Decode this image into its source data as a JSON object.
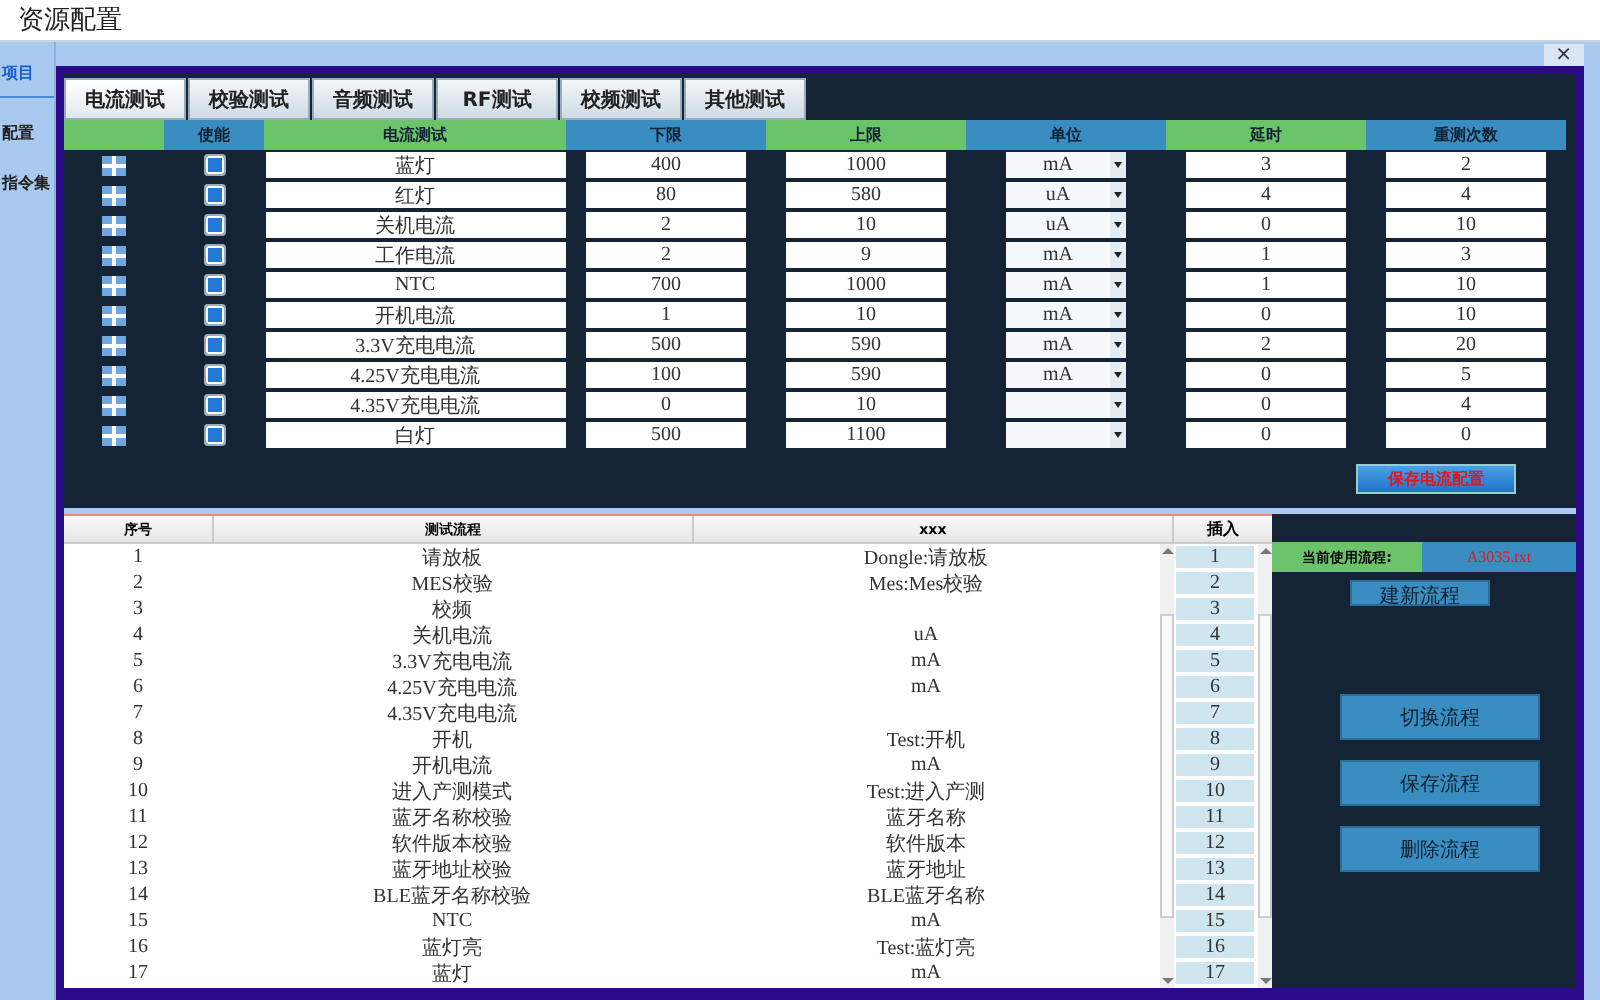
{
  "window": {
    "title": "资源配置",
    "close": "×"
  },
  "sidebar": {
    "items": [
      {
        "label": "项目",
        "selected": true
      },
      {
        "label": "配置",
        "selected": false
      },
      {
        "label": "指令集",
        "selected": false
      }
    ]
  },
  "tabs": [
    {
      "label": "电流测试",
      "selected": true
    },
    {
      "label": "校验测试",
      "selected": false
    },
    {
      "label": "音频测试",
      "selected": false
    },
    {
      "label": "RF测试",
      "selected": false
    },
    {
      "label": "校频测试",
      "selected": false
    },
    {
      "label": "其他测试",
      "selected": false
    }
  ],
  "current_table": {
    "columns": [
      "",
      "使能",
      "电流测试",
      "下限",
      "上限",
      "单位",
      "延时",
      "重测次数"
    ],
    "rows": [
      {
        "enabled": true,
        "name": "蓝灯",
        "low": "400",
        "high": "1000",
        "unit": "mA",
        "delay": "3",
        "retries": "2"
      },
      {
        "enabled": true,
        "name": "红灯",
        "low": "80",
        "high": "580",
        "unit": "uA",
        "delay": "4",
        "retries": "4"
      },
      {
        "enabled": true,
        "name": "关机电流",
        "low": "2",
        "high": "10",
        "unit": "uA",
        "delay": "0",
        "retries": "10"
      },
      {
        "enabled": true,
        "name": "工作电流",
        "low": "2",
        "high": "9",
        "unit": "mA",
        "delay": "1",
        "retries": "3"
      },
      {
        "enabled": true,
        "name": "NTC",
        "low": "700",
        "high": "1000",
        "unit": "mA",
        "delay": "1",
        "retries": "10"
      },
      {
        "enabled": true,
        "name": "开机电流",
        "low": "1",
        "high": "10",
        "unit": "mA",
        "delay": "0",
        "retries": "10"
      },
      {
        "enabled": true,
        "name": "3.3V充电电流",
        "low": "500",
        "high": "590",
        "unit": "mA",
        "delay": "2",
        "retries": "20"
      },
      {
        "enabled": true,
        "name": "4.25V充电电流",
        "low": "100",
        "high": "590",
        "unit": "mA",
        "delay": "0",
        "retries": "5"
      },
      {
        "enabled": true,
        "name": "4.35V充电电流",
        "low": "0",
        "high": "10",
        "delay": "0",
        "retries": "4"
      },
      {
        "enabled": true,
        "name": "白灯",
        "low": "500",
        "high": "1100",
        "delay": "0",
        "retries": "0"
      }
    ],
    "save_button": "保存电流配置"
  },
  "flow_table": {
    "columns": [
      "序号",
      "测试流程",
      "xxx"
    ],
    "insert_column": "插入",
    "rows": [
      {
        "index": "1",
        "step": "请放板",
        "value": "Dongle:请放板"
      },
      {
        "index": "2",
        "step": "MES校验",
        "value": "Mes:Mes校验"
      },
      {
        "index": "3",
        "step": "校频"
      },
      {
        "index": "4",
        "step": "关机电流",
        "value": "uA"
      },
      {
        "index": "5",
        "step": "3.3V充电电流",
        "value": "mA"
      },
      {
        "index": "6",
        "step": "4.25V充电电流",
        "value": "mA"
      },
      {
        "index": "7",
        "step": "4.35V充电电流"
      },
      {
        "index": "8",
        "step": "开机",
        "value": "Test:开机"
      },
      {
        "index": "9",
        "step": "开机电流",
        "value": "mA"
      },
      {
        "index": "10",
        "step": "进入产测模式",
        "value": "Test:进入产测"
      },
      {
        "index": "11",
        "step": "蓝牙名称校验",
        "value": "蓝牙名称"
      },
      {
        "index": "12",
        "step": "软件版本校验",
        "value": "软件版本"
      },
      {
        "index": "13",
        "step": "蓝牙地址校验",
        "value": "蓝牙地址"
      },
      {
        "index": "14",
        "step": "BLE蓝牙名称校验",
        "value": "BLE蓝牙名称"
      },
      {
        "index": "15",
        "step": "NTC",
        "value": "mA"
      },
      {
        "index": "16",
        "step": "蓝灯亮",
        "value": "Test:蓝灯亮"
      },
      {
        "index": "17",
        "step": "蓝灯",
        "value": "mA"
      }
    ],
    "insert_buttons": [
      "1",
      "2",
      "3",
      "4",
      "5",
      "6",
      "7",
      "8",
      "9",
      "10",
      "11",
      "12",
      "13",
      "14",
      "15",
      "16",
      "17"
    ]
  },
  "flow_panel": {
    "current_label": "当前使用流程:",
    "current_file": "A3035.txt",
    "buttons": [
      "建新流程",
      "切换流程",
      "保存流程",
      "删除流程"
    ]
  }
}
